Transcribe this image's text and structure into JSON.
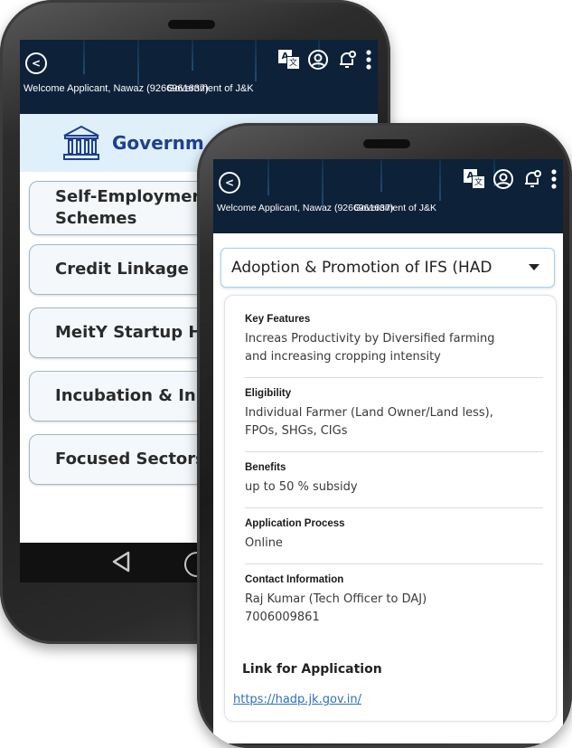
{
  "back_screen": {
    "header": {
      "welcome_text": "Welcome Applicant, Nawaz (9266961637)",
      "org_text": "Government of J&K"
    },
    "banner": {
      "title": "Governm",
      "icon": "bank-icon"
    },
    "menu": [
      {
        "line1": "Self-Employmer",
        "line2": "Schemes"
      },
      {
        "line1": "Credit Linkage",
        "line2": ""
      },
      {
        "line1": "MeitY Startup Hu",
        "line2": ""
      },
      {
        "line1": "Incubation & Inn",
        "line2": ""
      },
      {
        "line1": "Focused Sectors",
        "line2": ""
      }
    ]
  },
  "front_screen": {
    "header": {
      "welcome_text": "Welcome Applicant, Nawaz (9266961637)",
      "org_text": "Government of J&K"
    },
    "scheme_select": {
      "value": "Adoption & Promotion of IFS  (HAD"
    },
    "details": {
      "key_features": {
        "label": "Key Features",
        "line1": "Increas Productivity by Diversified farming",
        "line2": "and increasing cropping intensity"
      },
      "eligibility": {
        "label": "Eligibility",
        "line1": "Individual Farmer (Land Owner/Land less),",
        "line2": "FPOs, SHGs, CIGs"
      },
      "benefits": {
        "label": "Benefits",
        "value": "up to 50 % subsidy"
      },
      "application_process": {
        "label": "Application Process",
        "value": "Online"
      },
      "contact": {
        "label": "Contact Information",
        "line1": "Raj Kumar (Tech Officer to DAJ)",
        "line2": "7006009861"
      },
      "link_label": "Link for Application",
      "link_url": "https://hadp.jk.gov.in/"
    }
  },
  "icons": [
    "back-icon",
    "translate-icon",
    "profile-icon",
    "notification-icon",
    "more-icon",
    "chevron-down-icon",
    "nav-back-icon",
    "nav-home-icon"
  ],
  "colors": {
    "appbar": "#0d2138",
    "banner_bg": "#dff0fb",
    "gov_title": "#1f3f8f",
    "link": "#2f6fbf"
  }
}
